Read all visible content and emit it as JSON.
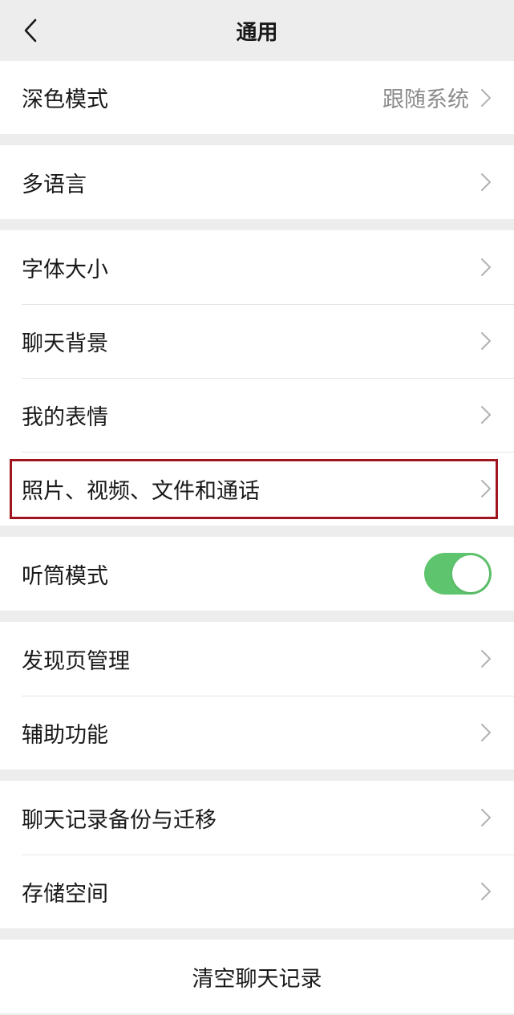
{
  "header": {
    "title": "通用"
  },
  "dark_mode": {
    "label": "深色模式",
    "value": "跟随系统"
  },
  "language": {
    "label": "多语言"
  },
  "display": {
    "font_size": "字体大小",
    "chat_background": "聊天背景",
    "my_stickers": "我的表情",
    "media": "照片、视频、文件和通话"
  },
  "earpiece": {
    "label": "听筒模式",
    "enabled": true
  },
  "discover": {
    "manage": "发现页管理",
    "accessibility": "辅助功能"
  },
  "storage": {
    "backup": "聊天记录备份与迁移",
    "space": "存储空间"
  },
  "clear_history": "清空聊天记录",
  "colors": {
    "toggle_on": "#5fc46e",
    "highlight": "#a0141e",
    "background": "#ededed"
  }
}
